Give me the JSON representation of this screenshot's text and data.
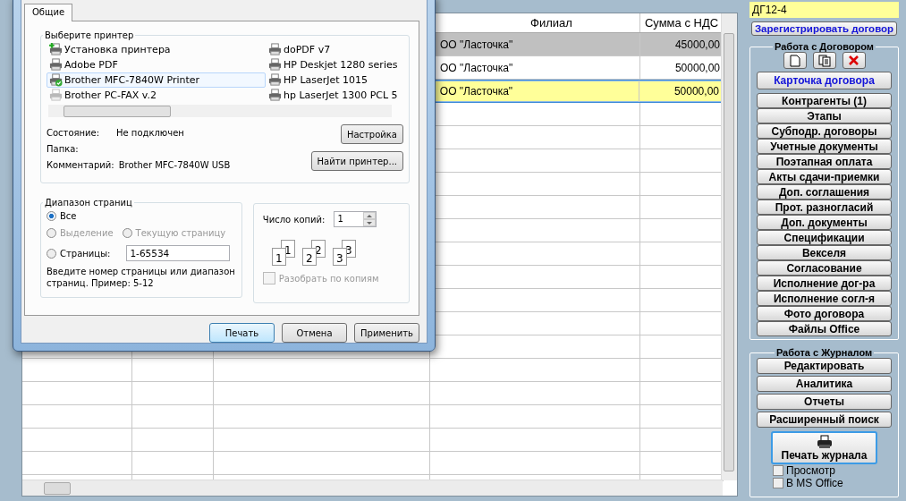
{
  "grid": {
    "columns": [
      "Филиал",
      "Сумма с НДС"
    ],
    "rows": [
      {
        "branch": "ОО \"Ласточка\"",
        "amount": "45000,00",
        "color": "#c0c0c0",
        "selected": false
      },
      {
        "branch": "ОО \"Ласточка\"",
        "amount": "50000,00",
        "color": "#ffffff",
        "selected": false
      },
      {
        "branch": "ОО \"Ласточка\"",
        "amount": "50000,00",
        "color": "#ffff99",
        "selected": true
      }
    ]
  },
  "dialog": {
    "tabs": [
      {
        "label": "Общие",
        "selected": true
      }
    ],
    "printer_group": {
      "title": "Выберите принтер",
      "printers": [
        {
          "name": "Установка принтера",
          "kind": "add",
          "selected": false
        },
        {
          "name": "Adobe PDF",
          "kind": "printer",
          "selected": false
        },
        {
          "name": "Brother MFC-7840W Printer",
          "kind": "default",
          "selected": true
        },
        {
          "name": "Brother PC-FAX v.2",
          "kind": "offline",
          "selected": false
        },
        {
          "name": "doPDF v7",
          "kind": "printer",
          "selected": false
        },
        {
          "name": "HP Deskjet 1280 series",
          "kind": "printer",
          "selected": false
        },
        {
          "name": "HP LaserJet 1015",
          "kind": "printer",
          "selected": false
        },
        {
          "name": "hp LaserJet 1300 PCL 5",
          "kind": "printer",
          "selected": false
        }
      ],
      "status_label": "Состояние:",
      "status": "Не подключен",
      "folder_label": "Папка:",
      "comment_label": "Комментарий:",
      "comment": "Brother MFC-7840W USB",
      "buttons": [
        "Настройка",
        "Найти принтер..."
      ]
    },
    "range_group": {
      "title": "Диапазон страниц",
      "options": [
        {
          "label": "Все",
          "selected": true,
          "disabled": false
        },
        {
          "label": "Выделение",
          "selected": false,
          "disabled": true
        },
        {
          "label": "Текущую страницу",
          "selected": false,
          "disabled": true
        },
        {
          "label": "Страницы:",
          "selected": false,
          "disabled": false
        }
      ],
      "pages_value": "1-65534",
      "hint": "Введите номер страницы или диапазон страниц.  Пример: 5-12"
    },
    "copies_group": {
      "label": "Число копий:",
      "value": "1",
      "collate_pages": [
        {
          "back": "1",
          "front": "1"
        },
        {
          "back": "2",
          "front": "2"
        },
        {
          "back": "3",
          "front": "3"
        }
      ],
      "collate": {
        "label": "Разобрать по копиям",
        "checked": false,
        "disabled": true
      }
    },
    "buttons": [
      {
        "label": "Печать",
        "default": true
      },
      {
        "label": "Отмена",
        "default": false
      },
      {
        "label": "Применить",
        "default": false
      }
    ]
  },
  "side": {
    "contract_number": "ДГ12-4",
    "register_button": "Зарегистрировать договор",
    "contract_group": {
      "title": "Работа с Договором",
      "card_button": "Карточка договора",
      "buttons": [
        "Контрагенты (1)",
        "Этапы",
        "Субподр. договоры",
        "Учетные документы",
        "Поэтапная оплата",
        "Акты сдачи-приемки",
        "Доп. соглашения",
        "Прот. разногласий",
        "Доп. документы",
        "Спецификации",
        "Векселя",
        "Согласование",
        "Исполнение дог-ра",
        "Исполнение согл-я",
        "Фото договора",
        "Файлы Office"
      ]
    },
    "journal_group": {
      "title": "Работа с Журналом",
      "buttons": [
        "Редактировать",
        "Аналитика",
        "Отчеты",
        "Расширенный поиск"
      ],
      "print_button": "Печать журнала",
      "options": [
        {
          "label": "Просмотр",
          "checked": false
        },
        {
          "label": "В MS Office",
          "checked": false
        }
      ]
    }
  }
}
